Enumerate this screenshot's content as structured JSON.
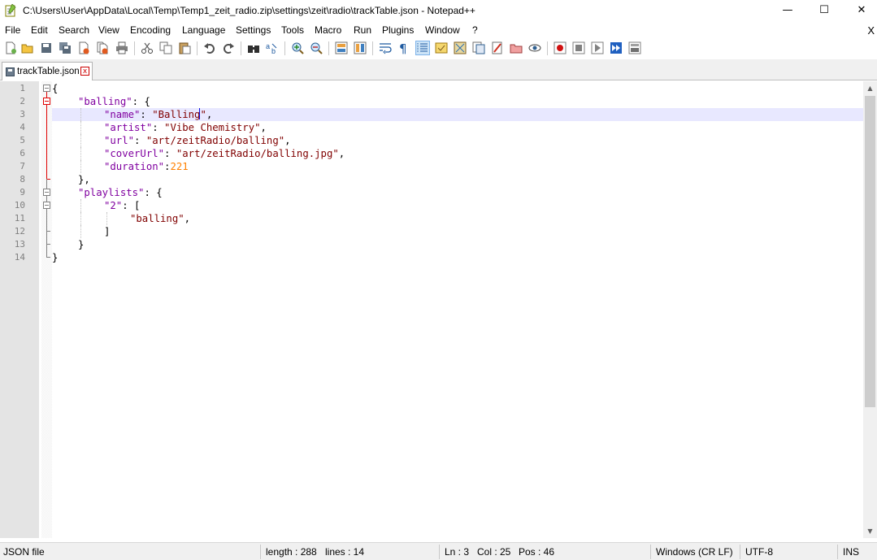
{
  "window": {
    "title": "C:\\Users\\User\\AppData\\Local\\Temp\\Temp1_zeit_radio.zip\\settings\\zeit\\radio\\trackTable.json - Notepad++",
    "minimize": "—",
    "maximize": "☐",
    "close": "✕"
  },
  "menu": {
    "items": [
      "File",
      "Edit",
      "Search",
      "View",
      "Encoding",
      "Language",
      "Settings",
      "Tools",
      "Macro",
      "Run",
      "Plugins",
      "Window",
      "?"
    ],
    "close_doc": "X"
  },
  "toolbar": {
    "icons": [
      "new-file-icon",
      "open-file-icon",
      "save-icon",
      "save-all-icon",
      "close-icon",
      "close-all-icon",
      "print-icon",
      "cut-icon",
      "copy-icon",
      "paste-icon",
      "undo-icon",
      "redo-icon",
      "find-icon",
      "replace-icon",
      "zoom-in-icon",
      "zoom-out-icon",
      "sync-vertical-icon",
      "sync-horizontal-icon",
      "word-wrap-icon",
      "show-all-chars-icon",
      "indent-guide-icon",
      "user-language-icon",
      "doc-map-icon",
      "function-list-icon",
      "folder-workspace-icon",
      "monitoring-icon",
      "record-macro-icon",
      "stop-macro-icon",
      "play-macro-icon",
      "run-macro-multiple-icon",
      "save-macro-icon"
    ]
  },
  "tab": {
    "label": "trackTable.json",
    "close": "x"
  },
  "editor": {
    "line_numbers": [
      "1",
      "2",
      "3",
      "4",
      "5",
      "6",
      "7",
      "8",
      "9",
      "10",
      "11",
      "12",
      "13",
      "14"
    ],
    "current_line": 3,
    "lines": [
      [
        {
          "t": "op",
          "v": "{"
        }
      ],
      [
        {
          "t": "key",
          "v": "\"balling\""
        },
        {
          "t": "op",
          "v": ": {"
        }
      ],
      [
        {
          "t": "key",
          "v": "\"name\""
        },
        {
          "t": "op",
          "v": ": "
        },
        {
          "t": "str",
          "v": "\"Balling"
        },
        {
          "t": "caret",
          "v": ""
        },
        {
          "t": "str",
          "v": "\""
        },
        {
          "t": "op",
          "v": ","
        }
      ],
      [
        {
          "t": "key",
          "v": "\"artist\""
        },
        {
          "t": "op",
          "v": ": "
        },
        {
          "t": "str",
          "v": "\"Vibe Chemistry\""
        },
        {
          "t": "op",
          "v": ","
        }
      ],
      [
        {
          "t": "key",
          "v": "\"url\""
        },
        {
          "t": "op",
          "v": ": "
        },
        {
          "t": "str",
          "v": "\"art/zeitRadio/balling\""
        },
        {
          "t": "op",
          "v": ","
        }
      ],
      [
        {
          "t": "key",
          "v": "\"coverUrl\""
        },
        {
          "t": "op",
          "v": ": "
        },
        {
          "t": "str",
          "v": "\"art/zeitRadio/balling.jpg\""
        },
        {
          "t": "op",
          "v": ","
        }
      ],
      [
        {
          "t": "key",
          "v": "\"duration\""
        },
        {
          "t": "op",
          "v": ":"
        },
        {
          "t": "num",
          "v": "221"
        }
      ],
      [
        {
          "t": "op",
          "v": "},"
        }
      ],
      [
        {
          "t": "key",
          "v": "\"playlists\""
        },
        {
          "t": "op",
          "v": ": {"
        }
      ],
      [
        {
          "t": "key",
          "v": "\"2\""
        },
        {
          "t": "op",
          "v": ": ["
        }
      ],
      [
        {
          "t": "str",
          "v": "\"balling\""
        },
        {
          "t": "op",
          "v": ","
        }
      ],
      [
        {
          "t": "op",
          "v": "]"
        }
      ],
      [
        {
          "t": "op",
          "v": "}"
        }
      ],
      [
        {
          "t": "op",
          "v": "}"
        }
      ]
    ],
    "indents": [
      0,
      1,
      2,
      2,
      2,
      2,
      2,
      1,
      1,
      2,
      3,
      2,
      1,
      0
    ]
  },
  "status": {
    "file_type": "JSON file",
    "length": "length : 288",
    "lines": "lines : 14",
    "ln": "Ln : 3",
    "col": "Col : 25",
    "pos": "Pos : 46",
    "eol": "Windows (CR LF)",
    "encoding": "UTF-8",
    "mode": "INS"
  },
  "colors": {
    "key": "#8000a0",
    "string": "#800000",
    "number": "#ff8000",
    "current_line": "#e8e8ff"
  }
}
